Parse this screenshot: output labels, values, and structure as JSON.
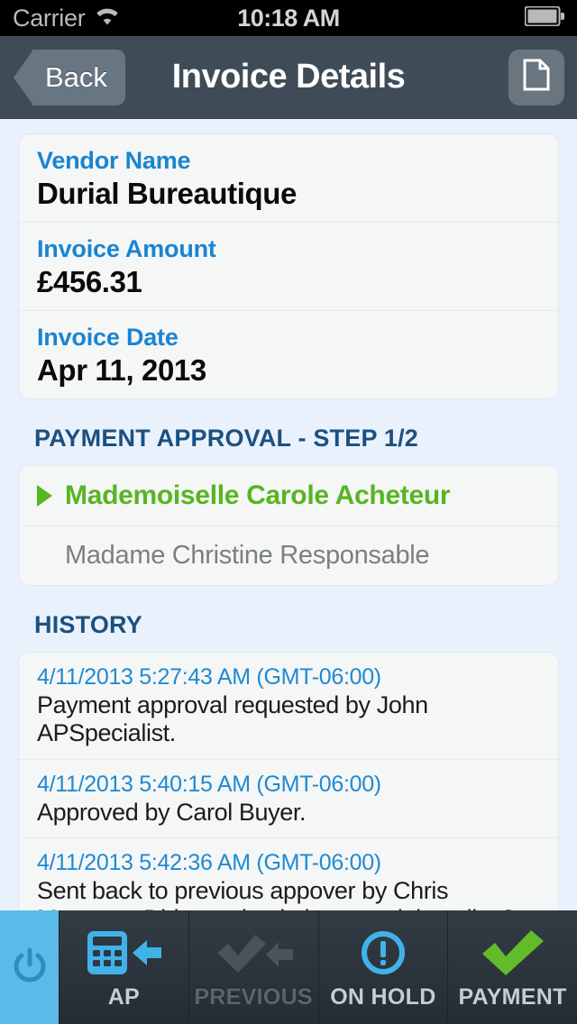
{
  "status_bar": {
    "carrier": "Carrier",
    "time": "10:18 AM",
    "wifi_icon": "wifi-icon",
    "battery_icon": "battery-full-icon"
  },
  "nav": {
    "back_label": "Back",
    "title": "Invoice Details",
    "document_icon": "document-icon"
  },
  "invoice": {
    "fields": [
      {
        "label": "Vendor Name",
        "value": "Durial Bureautique"
      },
      {
        "label": "Invoice Amount",
        "value": "£456.31"
      },
      {
        "label": "Invoice Date",
        "value": "Apr 11, 2013"
      }
    ]
  },
  "approval": {
    "heading": "PAYMENT APPROVAL - STEP 1/2",
    "approvers": [
      {
        "name": "Mademoiselle Carole Acheteur",
        "current": true
      },
      {
        "name": "Madame Christine Responsable",
        "current": false
      }
    ]
  },
  "history": {
    "heading": "HISTORY",
    "entries": [
      {
        "timestamp": "4/11/2013 5:27:43 AM (GMT-06:00)",
        "text": "Payment approval requested by John APSpecialist."
      },
      {
        "timestamp": "4/11/2013 5:40:15 AM (GMT-06:00)",
        "text": "Approved by Carol Buyer."
      },
      {
        "timestamp": "4/11/2013 5:42:36 AM (GMT-06:00)",
        "text": "Sent back to previous appover by Chris Manager:\nDid you check the material quality ?"
      }
    ]
  },
  "tabbar": {
    "power_icon": "power-icon",
    "tabs": [
      {
        "label": "AP",
        "icon": "calculator-arrow-left-icon",
        "state": "enabled"
      },
      {
        "label": "PREVIOUS",
        "icon": "check-arrow-left-icon",
        "state": "disabled"
      },
      {
        "label": "ON HOLD",
        "icon": "exclamation-circle-icon",
        "state": "enabled"
      },
      {
        "label": "PAYMENT",
        "icon": "check-icon",
        "state": "enabled"
      }
    ]
  },
  "colors": {
    "page_background": "#e9f2fc",
    "card_background": "#f5f6f6",
    "navbar": "#3f4c57",
    "label_blue": "#1a85d0",
    "section_blue": "#1d5080",
    "approved_green": "#57b522",
    "tab_accent_blue": "#5bbbe8",
    "tabbar_background": "#2c353d"
  }
}
